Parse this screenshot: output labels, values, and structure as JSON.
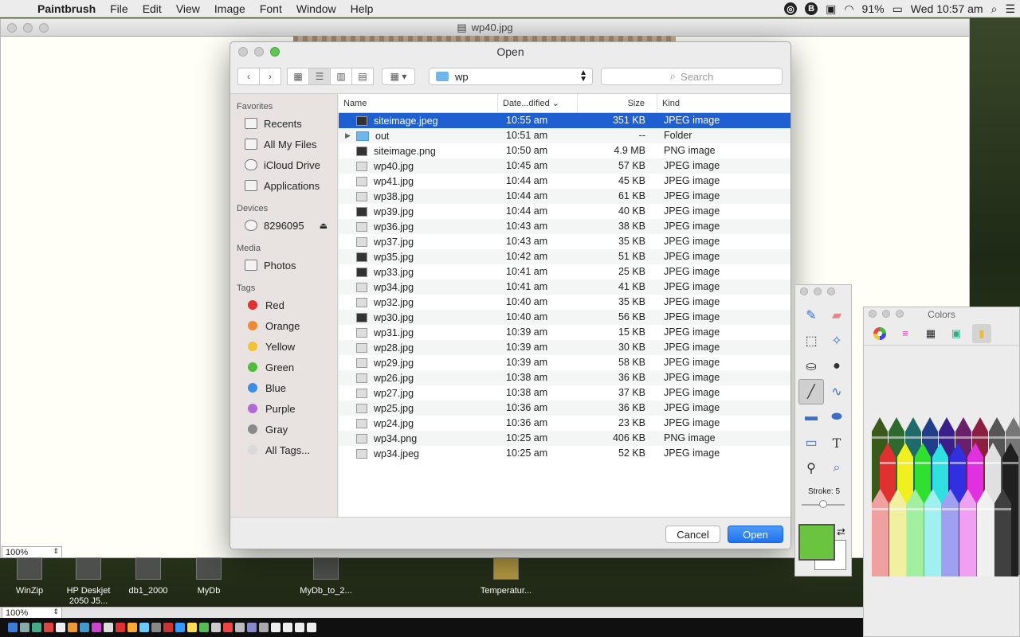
{
  "menubar": {
    "app_name": "Paintbrush",
    "items": [
      "File",
      "Edit",
      "View",
      "Image",
      "Font",
      "Window",
      "Help"
    ],
    "battery": "91%",
    "clock": "Wed 10:57 am"
  },
  "document": {
    "title": "wp40.jpg",
    "zoom_top": "100%",
    "zoom_bottom": "100%"
  },
  "desktop_icons": [
    {
      "label": "WinZip"
    },
    {
      "label": "HP Deskjet 2050 J5..."
    },
    {
      "label": "db1_2000"
    },
    {
      "label": "MyDb"
    },
    {
      "label": "MyDb_to_2..."
    },
    {
      "label": "Temperatur..."
    }
  ],
  "dialog": {
    "title": "Open",
    "location": "wp",
    "search_placeholder": "Search",
    "sidebar": {
      "favorites_header": "Favorites",
      "favorites": [
        "Recents",
        "All My Files",
        "iCloud Drive",
        "Applications"
      ],
      "devices_header": "Devices",
      "device": "8296095",
      "media_header": "Media",
      "media": [
        "Photos"
      ],
      "tags_header": "Tags",
      "tags": [
        {
          "label": "Red",
          "color": "#e0322f"
        },
        {
          "label": "Orange",
          "color": "#ee8a34"
        },
        {
          "label": "Yellow",
          "color": "#f3c336"
        },
        {
          "label": "Green",
          "color": "#4ebd3a"
        },
        {
          "label": "Blue",
          "color": "#3a8ee6"
        },
        {
          "label": "Purple",
          "color": "#b467d6"
        },
        {
          "label": "Gray",
          "color": "#8a8a8a"
        },
        {
          "label": "All Tags...",
          "color": "#dadada"
        }
      ]
    },
    "columns": {
      "name": "Name",
      "date": "Date...dified",
      "size": "Size",
      "kind": "Kind"
    },
    "files": [
      {
        "name": "siteimage.jpeg",
        "date": "10:55 am",
        "size": "351 KB",
        "kind": "JPEG image",
        "icon": "dark",
        "selected": true
      },
      {
        "name": "out",
        "date": "10:51 am",
        "size": "--",
        "kind": "Folder",
        "icon": "folder"
      },
      {
        "name": "siteimage.png",
        "date": "10:50 am",
        "size": "4.9 MB",
        "kind": "PNG image",
        "icon": "dark"
      },
      {
        "name": "wp40.jpg",
        "date": "10:45 am",
        "size": "57 KB",
        "kind": "JPEG image",
        "icon": "light"
      },
      {
        "name": "wp41.jpg",
        "date": "10:44 am",
        "size": "45 KB",
        "kind": "JPEG image",
        "icon": "light"
      },
      {
        "name": "wp38.jpg",
        "date": "10:44 am",
        "size": "61 KB",
        "kind": "JPEG image",
        "icon": "light"
      },
      {
        "name": "wp39.jpg",
        "date": "10:44 am",
        "size": "40 KB",
        "kind": "JPEG image",
        "icon": "dark"
      },
      {
        "name": "wp36.jpg",
        "date": "10:43 am",
        "size": "38 KB",
        "kind": "JPEG image",
        "icon": "light"
      },
      {
        "name": "wp37.jpg",
        "date": "10:43 am",
        "size": "35 KB",
        "kind": "JPEG image",
        "icon": "light"
      },
      {
        "name": "wp35.jpg",
        "date": "10:42 am",
        "size": "51 KB",
        "kind": "JPEG image",
        "icon": "dark"
      },
      {
        "name": "wp33.jpg",
        "date": "10:41 am",
        "size": "25 KB",
        "kind": "JPEG image",
        "icon": "dark"
      },
      {
        "name": "wp34.jpg",
        "date": "10:41 am",
        "size": "41 KB",
        "kind": "JPEG image",
        "icon": "light"
      },
      {
        "name": "wp32.jpg",
        "date": "10:40 am",
        "size": "35 KB",
        "kind": "JPEG image",
        "icon": "light"
      },
      {
        "name": "wp30.jpg",
        "date": "10:40 am",
        "size": "56 KB",
        "kind": "JPEG image",
        "icon": "dark"
      },
      {
        "name": "wp31.jpg",
        "date": "10:39 am",
        "size": "15 KB",
        "kind": "JPEG image",
        "icon": "light"
      },
      {
        "name": "wp28.jpg",
        "date": "10:39 am",
        "size": "30 KB",
        "kind": "JPEG image",
        "icon": "light"
      },
      {
        "name": "wp29.jpg",
        "date": "10:39 am",
        "size": "58 KB",
        "kind": "JPEG image",
        "icon": "light"
      },
      {
        "name": "wp26.jpg",
        "date": "10:38 am",
        "size": "36 KB",
        "kind": "JPEG image",
        "icon": "light"
      },
      {
        "name": "wp27.jpg",
        "date": "10:38 am",
        "size": "37 KB",
        "kind": "JPEG image",
        "icon": "light"
      },
      {
        "name": "wp25.jpg",
        "date": "10:36 am",
        "size": "36 KB",
        "kind": "JPEG image",
        "icon": "light"
      },
      {
        "name": "wp24.jpg",
        "date": "10:36 am",
        "size": "23 KB",
        "kind": "JPEG image",
        "icon": "light"
      },
      {
        "name": "wp34.png",
        "date": "10:25 am",
        "size": "406 KB",
        "kind": "PNG image",
        "icon": "light"
      },
      {
        "name": "wp34.jpeg",
        "date": "10:25 am",
        "size": "52 KB",
        "kind": "JPEG image",
        "icon": "light"
      }
    ],
    "cancel_label": "Cancel",
    "open_label": "Open"
  },
  "tool_palette": {
    "stroke_label": "Stroke: 5",
    "foreground_color": "#6bc43f",
    "background_color": "#ffffff"
  },
  "colors_panel": {
    "title": "Colors"
  },
  "accent_color": "#1f5fd1"
}
